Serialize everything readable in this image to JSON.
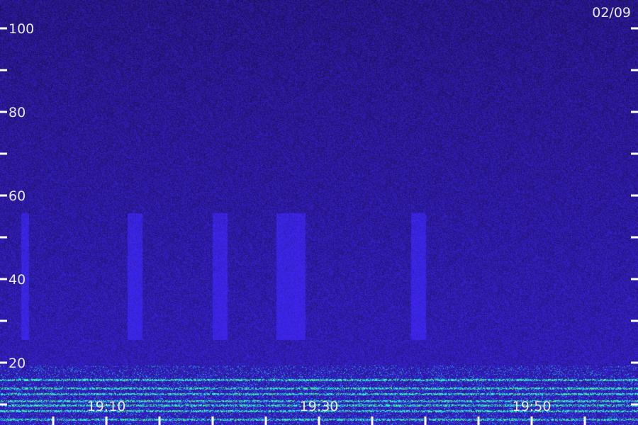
{
  "date_label": "02/09",
  "chart_data": {
    "type": "heatmap",
    "title": "",
    "xlabel": "",
    "ylabel": "",
    "x_ticks": [
      "19:10",
      "19:30",
      "19:50"
    ],
    "y_ticks": [
      "20",
      "40",
      "60",
      "80",
      "100"
    ],
    "ylim": [
      0,
      110
    ],
    "grid": false,
    "colors": {
      "background": "#14082e",
      "noise_low": "#2a1670",
      "noise_high": "#3a2cc8",
      "signal": "#2ee8d0",
      "signal_peak": "#6cff60",
      "tick": "#ffffff"
    }
  }
}
